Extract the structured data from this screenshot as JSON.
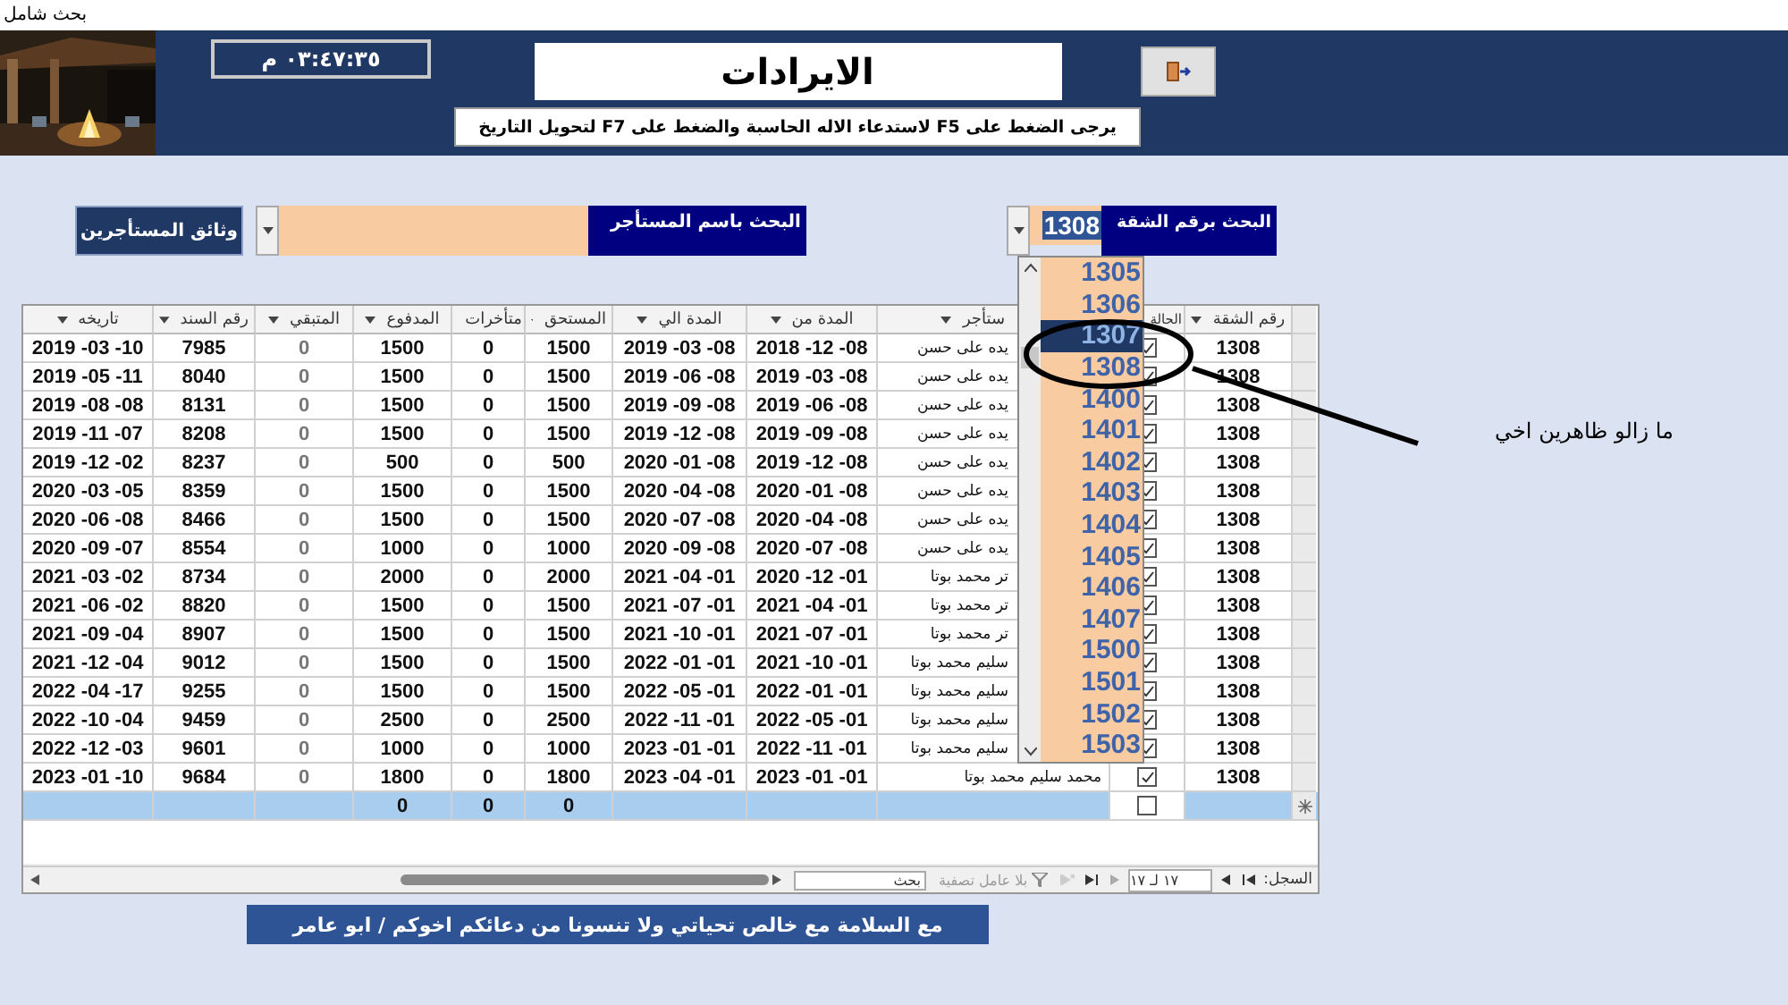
{
  "window": {
    "title": "بحث شامل"
  },
  "header": {
    "clock": "٠٣:٤٧:٣٥ م",
    "title": "الايرادات",
    "hint": "يرجى الضغط على F5 لاستدعاء الاله الحاسبة والضغط على F7 لتحويل التاريخ"
  },
  "search": {
    "documents_button": "وثائق المستأجرين",
    "name_label": "البحث باسم المستأجر",
    "apartment_label": "البحث برقم الشقة",
    "apartment_value": "1308"
  },
  "dropdown": [
    {
      "label": "1305",
      "selected": false
    },
    {
      "label": "1306",
      "selected": false
    },
    {
      "label": "1307",
      "selected": true
    },
    {
      "label": "1308",
      "selected": false
    },
    {
      "label": "1400",
      "selected": false
    },
    {
      "label": "1401",
      "selected": false
    },
    {
      "label": "1402",
      "selected": false
    },
    {
      "label": "1403",
      "selected": false
    },
    {
      "label": "1404",
      "selected": false
    },
    {
      "label": "1405",
      "selected": false
    },
    {
      "label": "1406",
      "selected": false
    },
    {
      "label": "1407",
      "selected": false
    },
    {
      "label": "1500",
      "selected": false
    },
    {
      "label": "1501",
      "selected": false
    },
    {
      "label": "1502",
      "selected": false
    },
    {
      "label": "1503",
      "selected": false
    }
  ],
  "table": {
    "columns": [
      {
        "label": "تاريخه",
        "kind": "date"
      },
      {
        "label": "رقم السند",
        "kind": "number"
      },
      {
        "label": "المتبقي",
        "kind": "number",
        "muted": true
      },
      {
        "label": "المدفوع",
        "kind": "number",
        "totaled": true
      },
      {
        "label": "متأخرات",
        "kind": "number",
        "totaled": true
      },
      {
        "label": "المستحق",
        "kind": "number",
        "totaled": true
      },
      {
        "label": "المدة الي",
        "kind": "date"
      },
      {
        "label": "المدة من",
        "kind": "date"
      },
      {
        "label": "ستأجر",
        "kind": "name"
      },
      {
        "label": "الحالة",
        "kind": "check"
      },
      {
        "label": "رقم الشقة",
        "kind": "number"
      }
    ],
    "rows": [
      {
        "checked": true,
        "cells": [
          "2019 -03 -10",
          "7985",
          "0",
          "1500",
          "0",
          "1500",
          "2019 -03 -08",
          "2018 -12 -08",
          "يده على حسن",
          "1308"
        ]
      },
      {
        "checked": true,
        "cells": [
          "2019 -05 -11",
          "8040",
          "0",
          "1500",
          "0",
          "1500",
          "2019 -06 -08",
          "2019 -03 -08",
          "يده على حسن",
          "1308"
        ]
      },
      {
        "checked": true,
        "cells": [
          "2019 -08 -08",
          "8131",
          "0",
          "1500",
          "0",
          "1500",
          "2019 -09 -08",
          "2019 -06 -08",
          "يده على حسن",
          "1308"
        ]
      },
      {
        "checked": true,
        "cells": [
          "2019 -11 -07",
          "8208",
          "0",
          "1500",
          "0",
          "1500",
          "2019 -12 -08",
          "2019 -09 -08",
          "يده على حسن",
          "1308"
        ]
      },
      {
        "checked": true,
        "cells": [
          "2019 -12 -02",
          "8237",
          "0",
          "500",
          "0",
          "500",
          "2020 -01 -08",
          "2019 -12 -08",
          "يده على حسن",
          "1308"
        ]
      },
      {
        "checked": true,
        "cells": [
          "2020 -03 -05",
          "8359",
          "0",
          "1500",
          "0",
          "1500",
          "2020 -04 -08",
          "2020 -01 -08",
          "يده على حسن",
          "1308"
        ]
      },
      {
        "checked": true,
        "cells": [
          "2020 -06 -08",
          "8466",
          "0",
          "1500",
          "0",
          "1500",
          "2020 -07 -08",
          "2020 -04 -08",
          "يده على حسن",
          "1308"
        ]
      },
      {
        "checked": true,
        "cells": [
          "2020 -09 -07",
          "8554",
          "0",
          "1000",
          "0",
          "1000",
          "2020 -09 -08",
          "2020 -07 -08",
          "يده على حسن",
          "1308"
        ]
      },
      {
        "checked": true,
        "cells": [
          "2021 -03 -02",
          "8734",
          "0",
          "2000",
          "0",
          "2000",
          "2021 -04 -01",
          "2020 -12 -01",
          "تر محمد بوتا",
          "1308"
        ]
      },
      {
        "checked": true,
        "cells": [
          "2021 -06 -02",
          "8820",
          "0",
          "1500",
          "0",
          "1500",
          "2021 -07 -01",
          "2021 -04 -01",
          "تر محمد بوتا",
          "1308"
        ]
      },
      {
        "checked": true,
        "cells": [
          "2021 -09 -04",
          "8907",
          "0",
          "1500",
          "0",
          "1500",
          "2021 -10 -01",
          "2021 -07 -01",
          "تر محمد بوتا",
          "1308"
        ]
      },
      {
        "checked": true,
        "cells": [
          "2021 -12 -04",
          "9012",
          "0",
          "1500",
          "0",
          "1500",
          "2022 -01 -01",
          "2021 -10 -01",
          "سليم محمد بوتا",
          "1308"
        ]
      },
      {
        "checked": true,
        "cells": [
          "2022 -04 -17",
          "9255",
          "0",
          "1500",
          "0",
          "1500",
          "2022 -05 -01",
          "2022 -01 -01",
          "سليم محمد بوتا",
          "1308"
        ]
      },
      {
        "checked": true,
        "cells": [
          "2022 -10 -04",
          "9459",
          "0",
          "2500",
          "0",
          "2500",
          "2022 -11 -01",
          "2022 -05 -01",
          "سليم محمد بوتا",
          "1308"
        ]
      },
      {
        "checked": true,
        "cells": [
          "2022 -12 -03",
          "9601",
          "0",
          "1000",
          "0",
          "1000",
          "2023 -01 -01",
          "2022 -11 -01",
          "سليم محمد بوتا",
          "1308"
        ]
      },
      {
        "checked": true,
        "cells": [
          "2023 -01 -10",
          "9684",
          "0",
          "1800",
          "0",
          "1800",
          "2023 -04 -01",
          "2023 -01 -01",
          "محمد سليم محمد بوتا",
          "1308"
        ]
      }
    ],
    "totals": {
      "checked": false,
      "values": [
        "0",
        "0",
        "0"
      ]
    }
  },
  "navigation": {
    "label": "السجل:",
    "position": "١٧ لـ ١٧",
    "filter": "بلا عامل تصفية",
    "search": {
      "placeholder": "بحث"
    }
  },
  "annotation": "ما زالو ظاهرين اخي",
  "footer": "مع السلامة مع خالص تحياتي ولا تنسونا من دعائكم اخوكم / ابو عامر"
}
